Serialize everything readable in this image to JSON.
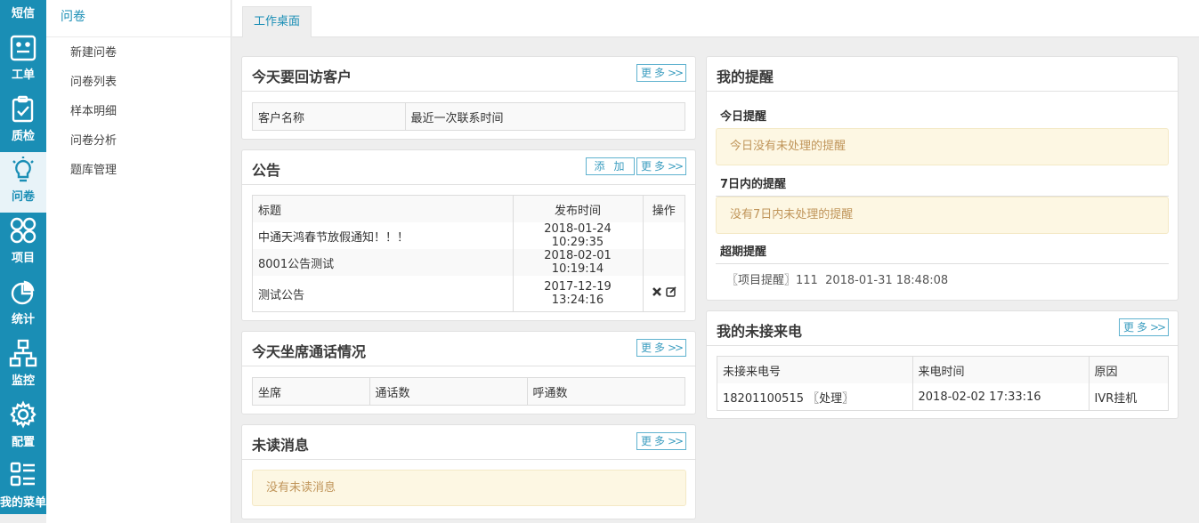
{
  "rail": [
    {
      "label": "短信",
      "icon": "sms-icon"
    },
    {
      "label": "工单",
      "icon": "ticket-icon"
    },
    {
      "label": "质检",
      "icon": "clipboard-check-icon"
    },
    {
      "label": "问卷",
      "icon": "lightbulb-icon",
      "active": true
    },
    {
      "label": "项目",
      "icon": "grid-icon"
    },
    {
      "label": "统计",
      "icon": "pie-chart-icon"
    },
    {
      "label": "监控",
      "icon": "sitemap-icon"
    },
    {
      "label": "配置",
      "icon": "gear-icon"
    },
    {
      "label": "我的菜单",
      "icon": "menu-list-icon"
    }
  ],
  "submenu": {
    "title": "问卷",
    "items": [
      "新建问卷",
      "问卷列表",
      "样本明细",
      "问卷分析",
      "题库管理"
    ]
  },
  "tabbar": {
    "active_tab": "工作桌面"
  },
  "buttons": {
    "more": "更多",
    "add": "添加"
  },
  "callback": {
    "title": "今天要回访客户",
    "columns": [
      "客户名称",
      "最近一次联系时间"
    ]
  },
  "announce": {
    "title": "公告",
    "columns": [
      "标题",
      "发布时间",
      "操作"
    ],
    "rows": [
      {
        "title": "中通天鸿春节放假通知！！！",
        "time": "2018-01-24 10:29:35"
      },
      {
        "title": "8001公告测试",
        "time": "2018-02-01 10:19:14"
      },
      {
        "title": "测试公告",
        "time": "2017-12-19 13:24:16"
      }
    ]
  },
  "agent_calls": {
    "title": "今天坐席通话情况",
    "columns": [
      "坐席",
      "通话数",
      "呼通数"
    ]
  },
  "unread": {
    "title": "未读消息",
    "empty": "没有未读消息"
  },
  "reminders": {
    "title": "我的提醒",
    "today_heading": "今日提醒",
    "today_empty": "今日没有未处理的提醒",
    "week_heading": "7日内的提醒",
    "week_empty": "没有7日内未处理的提醒",
    "overdue_heading": "超期提醒",
    "overdue_item": "〖项目提醒〗111  2018-01-31 18:48:08"
  },
  "missed": {
    "title": "我的未接来电",
    "columns": [
      "未接来电号",
      "来电时间",
      "原因"
    ],
    "rows": [
      {
        "number": "18201100515 〖处理〗",
        "time": "2018-02-02 17:33:16",
        "reason": "IVR挂机"
      }
    ]
  },
  "colors": {
    "rail_bg": "#1a8eb5",
    "accent": "#1a8eb5",
    "notice_bg": "#fdf7e3",
    "notice_text": "#c0955a"
  }
}
